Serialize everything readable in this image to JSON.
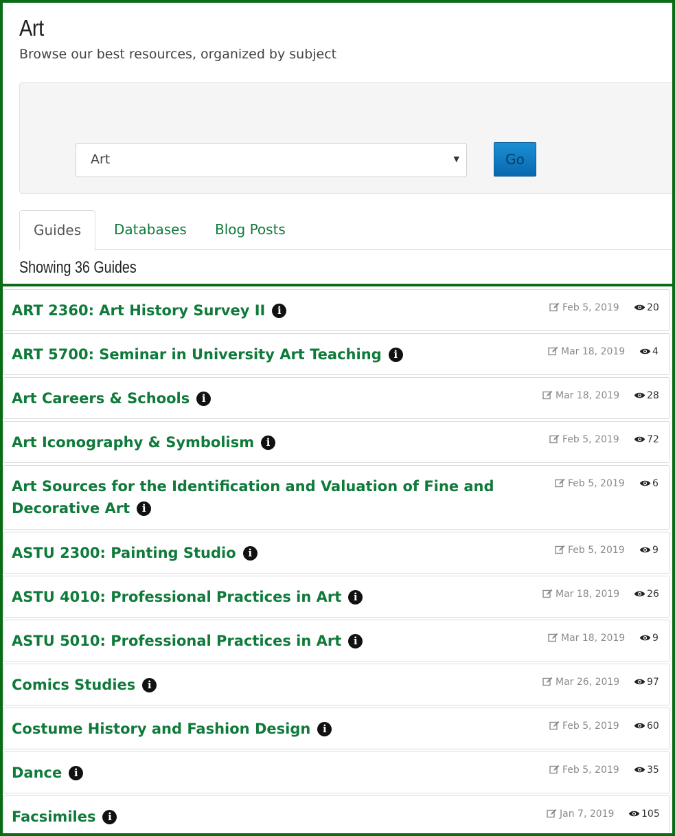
{
  "header": {
    "title": "Art",
    "subtitle": "Browse our best resources, organized by subject"
  },
  "filter": {
    "subject_value": "Art",
    "go_label": "Go"
  },
  "tabs": [
    {
      "label": "Guides",
      "active": true
    },
    {
      "label": "Databases",
      "active": false
    },
    {
      "label": "Blog Posts",
      "active": false
    }
  ],
  "showing_text": "Showing 36 Guides",
  "colors": {
    "frame": "#0b6b17",
    "link": "#0f7a3a",
    "go_button": "#0a7bc4"
  },
  "icons": {
    "info": "info-circle-icon",
    "edit": "edit-icon",
    "views": "eye-icon",
    "caret": "caret-down-icon"
  },
  "guides": [
    {
      "title": "ART 2360: Art History Survey II",
      "updated": "Feb 5, 2019",
      "views": "20"
    },
    {
      "title": "ART 5700: Seminar in University Art Teaching",
      "updated": "Mar 18, 2019",
      "views": "4"
    },
    {
      "title": "Art Careers & Schools",
      "updated": "Mar 18, 2019",
      "views": "28"
    },
    {
      "title": "Art Iconography & Symbolism",
      "updated": "Feb 5, 2019",
      "views": "72"
    },
    {
      "title": "Art Sources for the Identification and Valuation of Fine and Decorative Art",
      "updated": "Feb 5, 2019",
      "views": "6"
    },
    {
      "title": "ASTU 2300: Painting Studio",
      "updated": "Feb 5, 2019",
      "views": "9"
    },
    {
      "title": "ASTU 4010: Professional Practices in Art",
      "updated": "Mar 18, 2019",
      "views": "26"
    },
    {
      "title": "ASTU 5010: Professional Practices in Art",
      "updated": "Mar 18, 2019",
      "views": "9"
    },
    {
      "title": "Comics Studies",
      "updated": "Mar 26, 2019",
      "views": "97"
    },
    {
      "title": "Costume History and Fashion Design",
      "updated": "Feb 5, 2019",
      "views": "60"
    },
    {
      "title": "Dance",
      "updated": "Feb 5, 2019",
      "views": "35"
    },
    {
      "title": "Facsimiles",
      "updated": "Jan 7, 2019",
      "views": "105"
    }
  ]
}
